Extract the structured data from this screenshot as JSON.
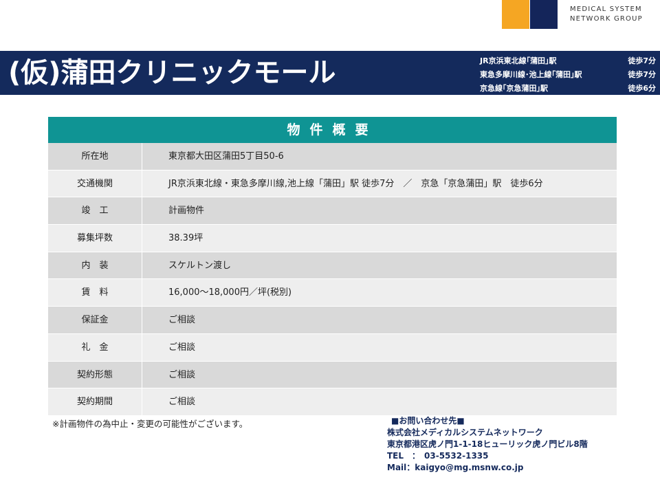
{
  "logo": {
    "line1": "MEDICAL SYSTEM",
    "line2": "NETWORK GROUP",
    "colors": {
      "orange": "#f5a623",
      "navy": "#14255a"
    }
  },
  "header": {
    "title": "(仮)蒲田クリニックモール",
    "access": [
      {
        "line": "JR京浜東北線｢蒲田｣駅",
        "walk": "徒歩7分"
      },
      {
        "line": "東急多摩川線･池上線｢蒲田｣駅",
        "walk": "徒歩7分"
      },
      {
        "line": "京急線｢京急蒲田｣駅",
        "walk": "徒歩6分"
      }
    ],
    "background": "#142a5c"
  },
  "table": {
    "heading": "物件概要",
    "header_color": "#0f9494",
    "rows": [
      {
        "label": "所在地",
        "value": "東京都大田区蒲田5丁目50-6"
      },
      {
        "label": "交通機関",
        "value": "JR京浜東北線・東急多摩川線,池上線「蒲田」駅 徒歩7分　／　京急「京急蒲田」駅　徒歩6分"
      },
      {
        "label": "竣　工",
        "value": "計画物件"
      },
      {
        "label": "募集坪数",
        "value": "38.39坪"
      },
      {
        "label": "内　装",
        "value": "スケルトン渡し"
      },
      {
        "label": "賃　料",
        "value": "16,000～18,000円／坪(税別)"
      },
      {
        "label": "保証金",
        "value": "ご相談"
      },
      {
        "label": "礼　金",
        "value": "ご相談"
      },
      {
        "label": "契約形態",
        "value": "ご相談"
      },
      {
        "label": "契約期間",
        "value": "ご相談"
      }
    ]
  },
  "note": "※計画物件の為中止・変更の可能性がございます。",
  "contact": {
    "heading": "■お問い合わせ先■",
    "company": "株式会社メディカルシステムネットワーク",
    "address": "東京都港区虎ノ門1-1-18ヒューリック虎ノ門ビル8階",
    "tel": "TEL　：　03-5532-1335",
    "mail": "Mail：kaigyo@mg.msnw.co.jp"
  }
}
